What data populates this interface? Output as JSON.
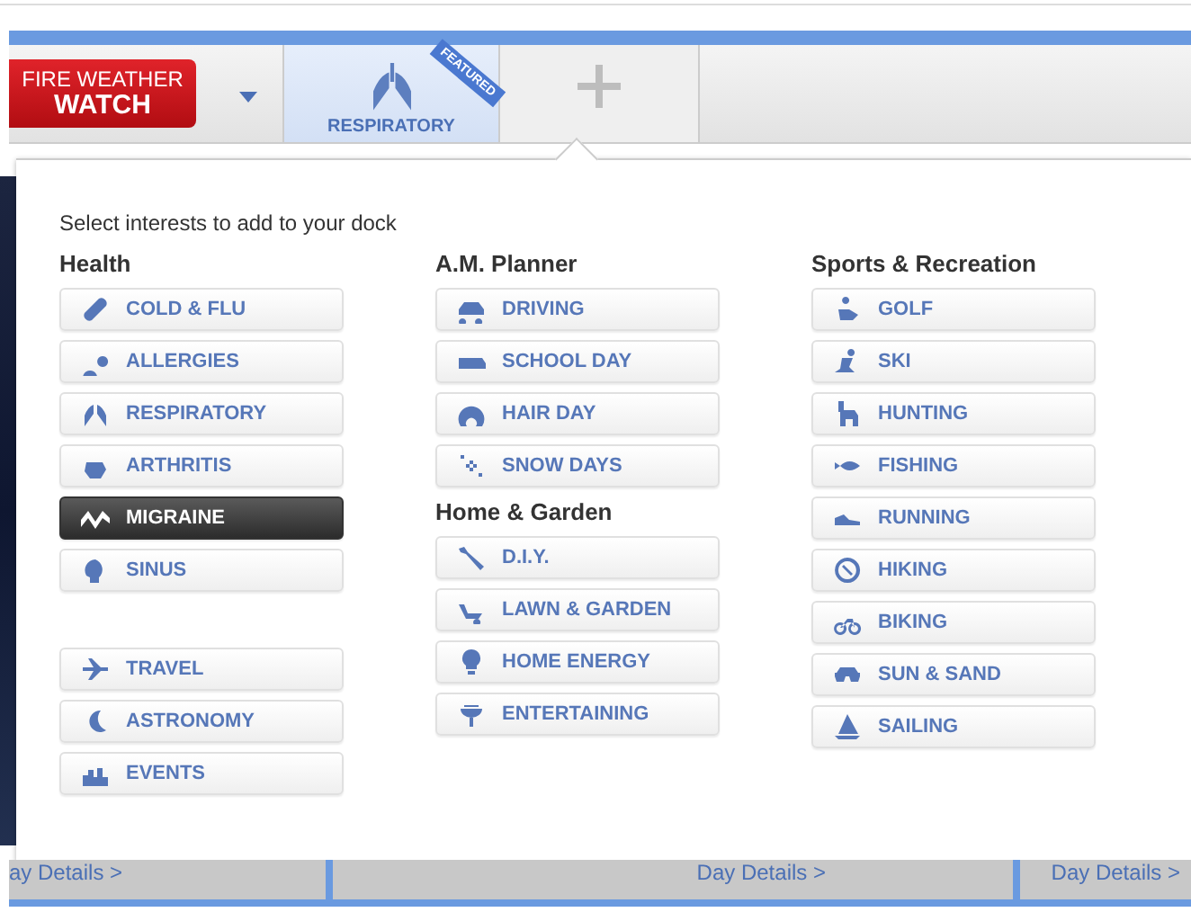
{
  "alert": {
    "line1": "FIRE WEATHER",
    "line2": "WATCH"
  },
  "dock_tabs": [
    {
      "label": "RESPIRATORY",
      "badge": "FEATURED",
      "selected": true
    }
  ],
  "panel": {
    "instruction": "Select interests to add to your dock",
    "columns": [
      {
        "groups": [
          {
            "heading": "Health",
            "items": [
              {
                "label": "COLD & FLU",
                "selected": false
              },
              {
                "label": "ALLERGIES",
                "selected": false
              },
              {
                "label": "RESPIRATORY",
                "selected": false
              },
              {
                "label": "ARTHRITIS",
                "selected": false
              },
              {
                "label": "MIGRAINE",
                "selected": true
              },
              {
                "label": "SINUS",
                "selected": false
              }
            ]
          },
          {
            "items": [
              {
                "label": "TRAVEL",
                "selected": false
              },
              {
                "label": "ASTRONOMY",
                "selected": false
              },
              {
                "label": "EVENTS",
                "selected": false
              }
            ]
          }
        ]
      },
      {
        "groups": [
          {
            "heading": "A.M. Planner",
            "items": [
              {
                "label": "DRIVING",
                "selected": false
              },
              {
                "label": "SCHOOL DAY",
                "selected": false
              },
              {
                "label": "HAIR DAY",
                "selected": false
              },
              {
                "label": "SNOW DAYS",
                "selected": false
              }
            ]
          },
          {
            "heading": "Home & Garden",
            "items": [
              {
                "label": "D.I.Y.",
                "selected": false
              },
              {
                "label": "LAWN & GARDEN",
                "selected": false
              },
              {
                "label": "HOME ENERGY",
                "selected": false
              },
              {
                "label": "ENTERTAINING",
                "selected": false
              }
            ]
          }
        ]
      },
      {
        "groups": [
          {
            "heading": "Sports & Recreation",
            "items": [
              {
                "label": "GOLF",
                "selected": false
              },
              {
                "label": "SKI",
                "selected": false
              },
              {
                "label": "HUNTING",
                "selected": false
              },
              {
                "label": "FISHING",
                "selected": false
              },
              {
                "label": "RUNNING",
                "selected": false
              },
              {
                "label": "HIKING",
                "selected": false
              },
              {
                "label": "BIKING",
                "selected": false
              },
              {
                "label": "SUN & SAND",
                "selected": false
              },
              {
                "label": "SAILING",
                "selected": false
              }
            ]
          }
        ]
      }
    ]
  },
  "footer_links": [
    "ay Details >",
    "Day Details >",
    "Day Details >"
  ]
}
